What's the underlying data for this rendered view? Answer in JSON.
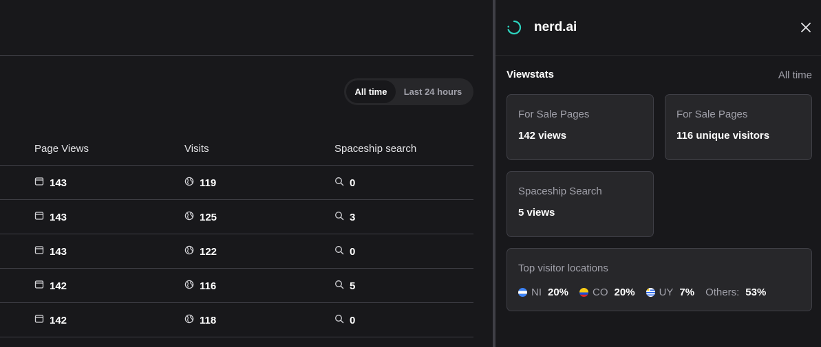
{
  "toggle": {
    "all_time": "All time",
    "last_24": "Last 24 hours"
  },
  "table": {
    "headers": {
      "page_views": "Page Views",
      "visits": "Visits",
      "search": "Spaceship search"
    },
    "rows": [
      {
        "page_views": "143",
        "visits": "119",
        "search": "0"
      },
      {
        "page_views": "143",
        "visits": "125",
        "search": "3"
      },
      {
        "page_views": "143",
        "visits": "122",
        "search": "0"
      },
      {
        "page_views": "142",
        "visits": "116",
        "search": "5"
      },
      {
        "page_views": "142",
        "visits": "118",
        "search": "0"
      }
    ]
  },
  "panel": {
    "domain": "nerd.ai",
    "section_title": "Viewstats",
    "range": "All time",
    "cards": [
      {
        "label": "For Sale Pages",
        "value": "142 views"
      },
      {
        "label": "For Sale Pages",
        "value": "116 unique visitors"
      },
      {
        "label": "Spaceship Search",
        "value": "5 views"
      }
    ],
    "locations": {
      "title": "Top visitor locations",
      "items": [
        {
          "code": "NI",
          "pct": "20%"
        },
        {
          "code": "CO",
          "pct": "20%"
        },
        {
          "code": "UY",
          "pct": "7%"
        }
      ],
      "others_label": "Others:",
      "others_pct": "53%"
    }
  },
  "colors": {
    "accent": "#2dd4bf",
    "background": "#18181b",
    "card": "#27272a"
  },
  "icons": {
    "page_views": "browser-window-icon",
    "visits": "globe-icon",
    "search": "search-icon",
    "close": "close-icon",
    "brand": "spinner-icon"
  }
}
